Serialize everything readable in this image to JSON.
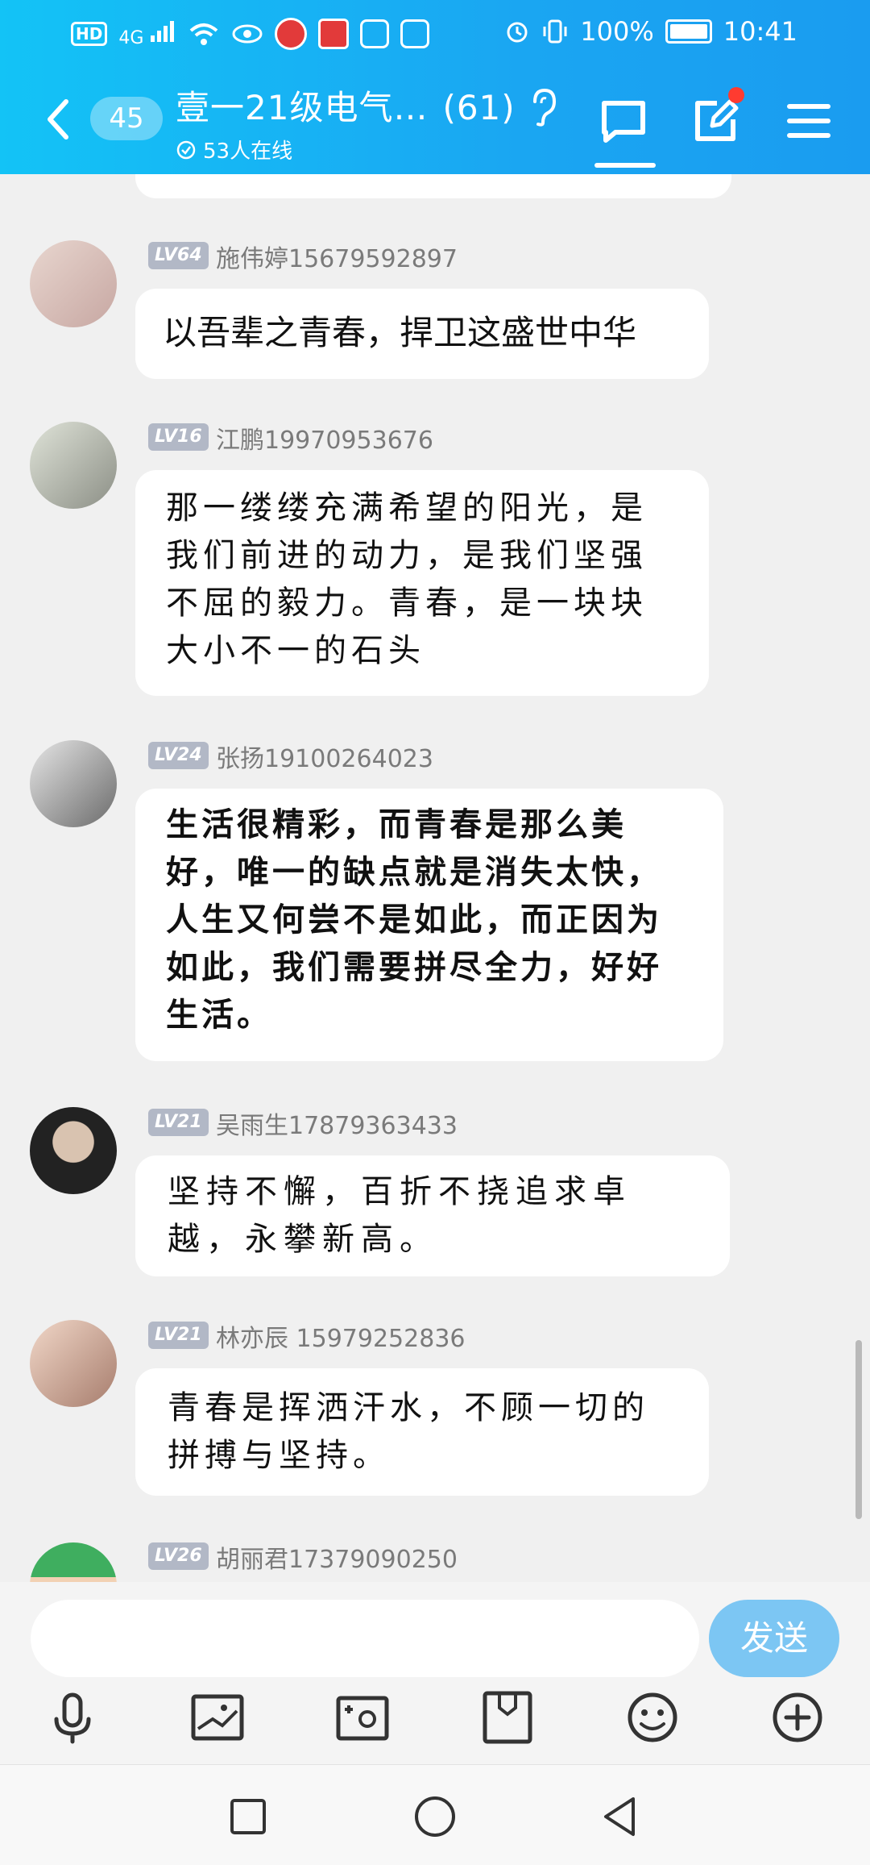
{
  "status_bar": {
    "hd_label": "HD",
    "network_label": "4G",
    "battery_percent": "100%",
    "time": "10:41"
  },
  "header": {
    "unread_count": "45",
    "group_title": "壹一21级电气…",
    "member_count": "(61)",
    "online_text": "53人在线"
  },
  "messages": [
    {
      "level": "LV64",
      "name": "施伟婷15679592897",
      "text": "以吾辈之青春，捍卫这盛世中华"
    },
    {
      "level": "LV16",
      "name": "江鹏19970953676",
      "text": "那一缕缕充满希望的阳光，是我们前进的动力，是我们坚强不屈的毅力。青春，是一块块大小不一的石头"
    },
    {
      "level": "LV24",
      "name": "张扬19100264023",
      "text": "生活很精彩，而青春是那么美好，唯一的缺点就是消失太快，人生又何尝不是如此，而正因为如此，我们需要拼尽全力，好好生活。"
    },
    {
      "level": "LV21",
      "name": "吴雨生17879363433",
      "text": "坚持不懈，百折不挠追求卓越，永攀新高。"
    },
    {
      "level": "LV21",
      "name": "林亦辰 15979252836",
      "text": "青春是挥洒汗水，不顾一切的拼搏与坚持。"
    },
    {
      "level": "LV26",
      "name": "胡丽君17379090250",
      "text": ""
    }
  ],
  "composer": {
    "input_value": "",
    "send_label": "发送"
  },
  "colors": {
    "header_bg": "#1aa6f2",
    "send_button": "#7cc6f3",
    "level_badge": "#b2b8c6",
    "notify_dot": "#ff3b30"
  },
  "icons": [
    "back-icon",
    "chat-icon",
    "edit-icon",
    "menu-icon",
    "ear-icon",
    "mic-icon",
    "image-icon",
    "camera-icon",
    "folder-icon",
    "emoji-icon",
    "plus-icon"
  ]
}
